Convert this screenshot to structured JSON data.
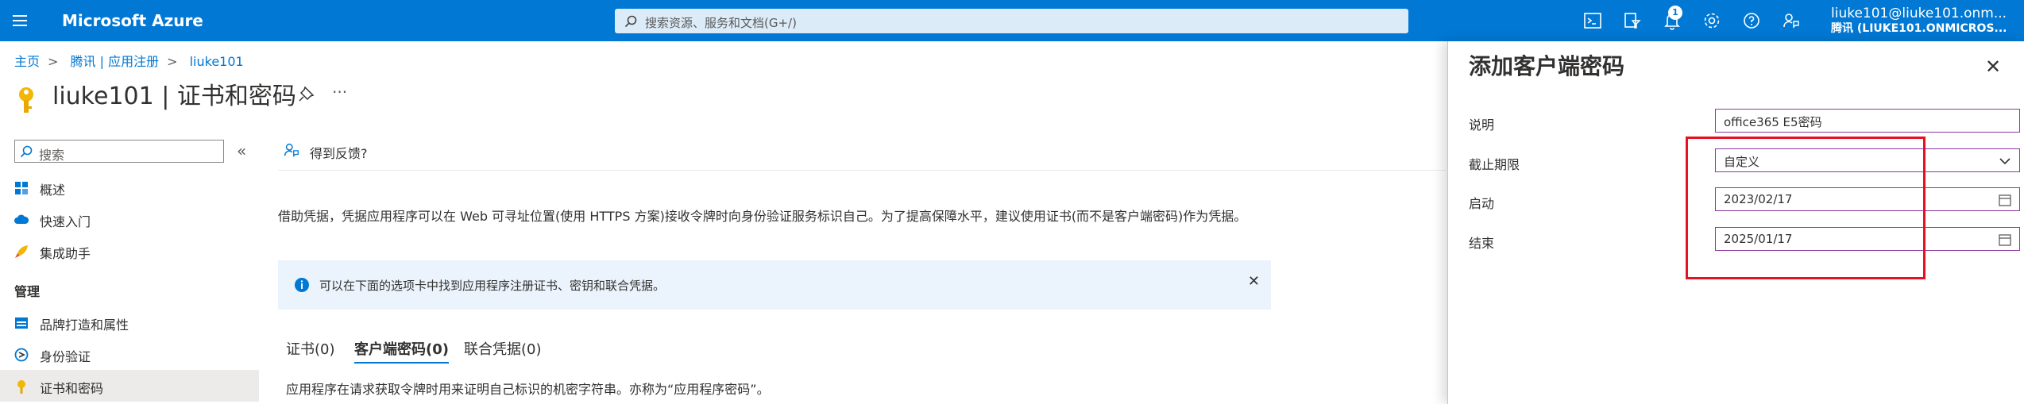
{
  "topbar": {
    "brand": "Microsoft Azure",
    "search_placeholder": "搜索资源、服务和文档(G+/)",
    "notification_count": "1",
    "account_user": "liuke101@liuke101.onm...",
    "account_tenant": "腾讯 (LIUKE101.ONMICROS..."
  },
  "breadcrumb": [
    "主页",
    "腾讯 | 应用注册",
    "liuke101"
  ],
  "page": {
    "title": "liuke101 | 证书和密码",
    "more": "···"
  },
  "left_nav": {
    "search_placeholder": "搜索",
    "collapse": "«",
    "items": [
      {
        "label": "概述",
        "icon": "grid-icon"
      },
      {
        "label": "快速入门",
        "icon": "cloud-icon"
      },
      {
        "label": "集成助手",
        "icon": "rocket-icon"
      }
    ],
    "section_label": "管理",
    "manage_items": [
      {
        "label": "品牌打造和属性",
        "icon": "branding-icon"
      },
      {
        "label": "身份验证",
        "icon": "auth-icon"
      },
      {
        "label": "证书和密码",
        "icon": "key-icon"
      }
    ]
  },
  "main": {
    "feedback_label": "得到反馈?",
    "description": "借助凭据，凭据应用程序可以在 Web 可寻址位置(使用 HTTPS 方案)接收令牌时向身份验证服务标识自己。为了提高保障水平，建议使用证书(而不是客户端密码)作为凭据。",
    "info_text": "可以在下面的选项卡中找到应用程序注册证书、密钥和联合凭据。",
    "tabs": [
      "证书(0)",
      "客户端密码(0)",
      "联合凭据(0)"
    ],
    "bottom_description": "应用程序在请求获取令牌时用来证明自己标识的机密字符串。亦称为“应用程序密码”。"
  },
  "panel": {
    "title": "添加客户端密码",
    "fields": [
      {
        "label": "说明",
        "value": "office365 E5密码"
      },
      {
        "label": "截止期限",
        "value": "自定义"
      },
      {
        "label": "启动",
        "value": "2023/02/17"
      },
      {
        "label": "结束",
        "value": "2025/01/17"
      }
    ]
  },
  "colors": {
    "accent": "#0078d4",
    "highlight": "#e81123"
  }
}
